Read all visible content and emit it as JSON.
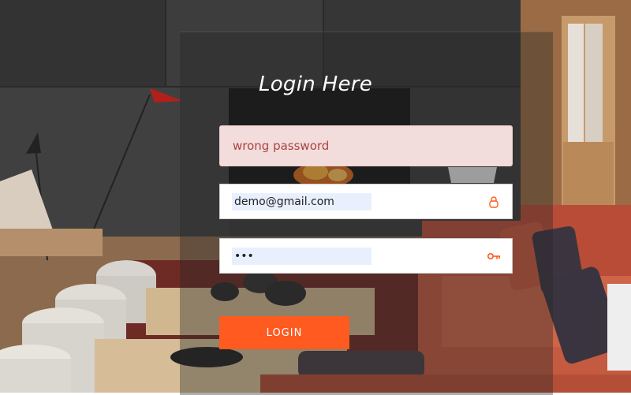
{
  "login": {
    "title": "Login Here",
    "error_message": "wrong password",
    "email_value": "demo@gmail.com",
    "password_value": "•••",
    "submit_label": "LOGIN"
  },
  "icons": {
    "email_field": "user-icon",
    "password_field": "key-icon"
  },
  "colors": {
    "accent": "#ff5a1f",
    "error_bg": "#f3dcdc",
    "error_text": "#a94442",
    "autofill_bg": "#e8f0fe"
  }
}
